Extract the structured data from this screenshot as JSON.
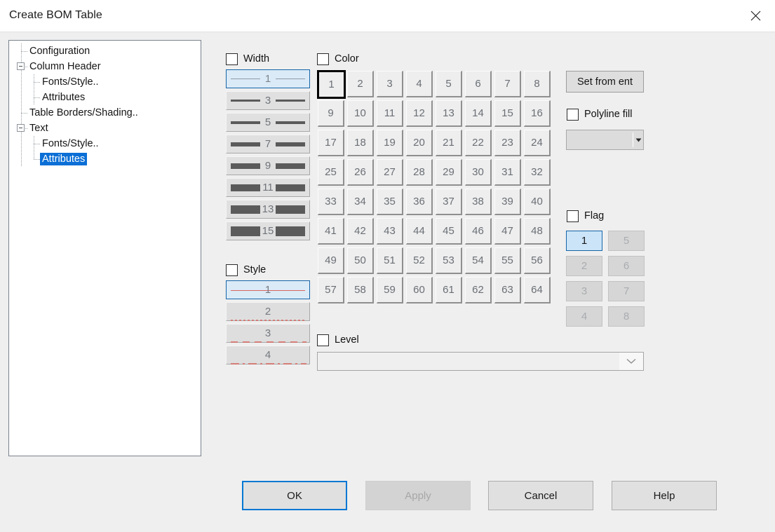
{
  "window": {
    "title": "Create BOM Table",
    "close_icon": "close-icon"
  },
  "tree": {
    "items": [
      {
        "label": "Configuration",
        "level": 0,
        "expander": false,
        "selected": false
      },
      {
        "label": "Column Header",
        "level": 0,
        "expander": true,
        "selected": false
      },
      {
        "label": "Fonts/Style..",
        "level": 1,
        "expander": false,
        "selected": false
      },
      {
        "label": "Attributes",
        "level": 1,
        "expander": false,
        "selected": false
      },
      {
        "label": "Table Borders/Shading..",
        "level": 0,
        "expander": false,
        "selected": false
      },
      {
        "label": "Text",
        "level": 0,
        "expander": true,
        "selected": false
      },
      {
        "label": "Fonts/Style..",
        "level": 1,
        "expander": false,
        "selected": false
      },
      {
        "label": "Attributes",
        "level": 1,
        "expander": false,
        "selected": true
      }
    ]
  },
  "width": {
    "checkbox_label": "Width",
    "checked": false,
    "selected_value": "1",
    "options": [
      {
        "value": "1",
        "thickness": 1
      },
      {
        "value": "3",
        "thickness": 3
      },
      {
        "value": "5",
        "thickness": 4
      },
      {
        "value": "7",
        "thickness": 6
      },
      {
        "value": "9",
        "thickness": 8
      },
      {
        "value": "11",
        "thickness": 10
      },
      {
        "value": "13",
        "thickness": 12
      },
      {
        "value": "15",
        "thickness": 14
      }
    ]
  },
  "style": {
    "checkbox_label": "Style",
    "checked": false,
    "selected_value": "1",
    "line_color": "#d9665e",
    "options": [
      {
        "value": "1",
        "dash": "solid"
      },
      {
        "value": "2",
        "dash": "dotted"
      },
      {
        "value": "3",
        "dash": "dashed"
      },
      {
        "value": "4",
        "dash": "dash-dot"
      }
    ]
  },
  "color": {
    "checkbox_label": "Color",
    "checked": false,
    "selected_value": "1",
    "columns": 8,
    "values": [
      "1",
      "2",
      "3",
      "4",
      "5",
      "6",
      "7",
      "8",
      "9",
      "10",
      "11",
      "12",
      "13",
      "14",
      "15",
      "16",
      "17",
      "18",
      "19",
      "20",
      "21",
      "22",
      "23",
      "24",
      "25",
      "26",
      "27",
      "28",
      "29",
      "30",
      "31",
      "32",
      "33",
      "34",
      "35",
      "36",
      "37",
      "38",
      "39",
      "40",
      "41",
      "42",
      "43",
      "44",
      "45",
      "46",
      "47",
      "48",
      "49",
      "50",
      "51",
      "52",
      "53",
      "54",
      "55",
      "56",
      "57",
      "58",
      "59",
      "60",
      "61",
      "62",
      "63",
      "64"
    ]
  },
  "level": {
    "checkbox_label": "Level",
    "checked": false,
    "combo_value": "",
    "combo_placeholder": ""
  },
  "right_panel": {
    "set_from_ent_label": "Set from ent",
    "polyline_fill_label": "Polyline fill",
    "polyline_fill_checked": false,
    "polyline_combo_value": "",
    "flag_label": "Flag",
    "flag_checked": false,
    "flag_selected": "1",
    "flag_values_left": [
      "1",
      "2",
      "3",
      "4"
    ],
    "flag_values_right": [
      "5",
      "6",
      "7",
      "8"
    ]
  },
  "buttons": {
    "ok": "OK",
    "apply": "Apply",
    "apply_disabled": true,
    "cancel": "Cancel",
    "help": "Help"
  }
}
